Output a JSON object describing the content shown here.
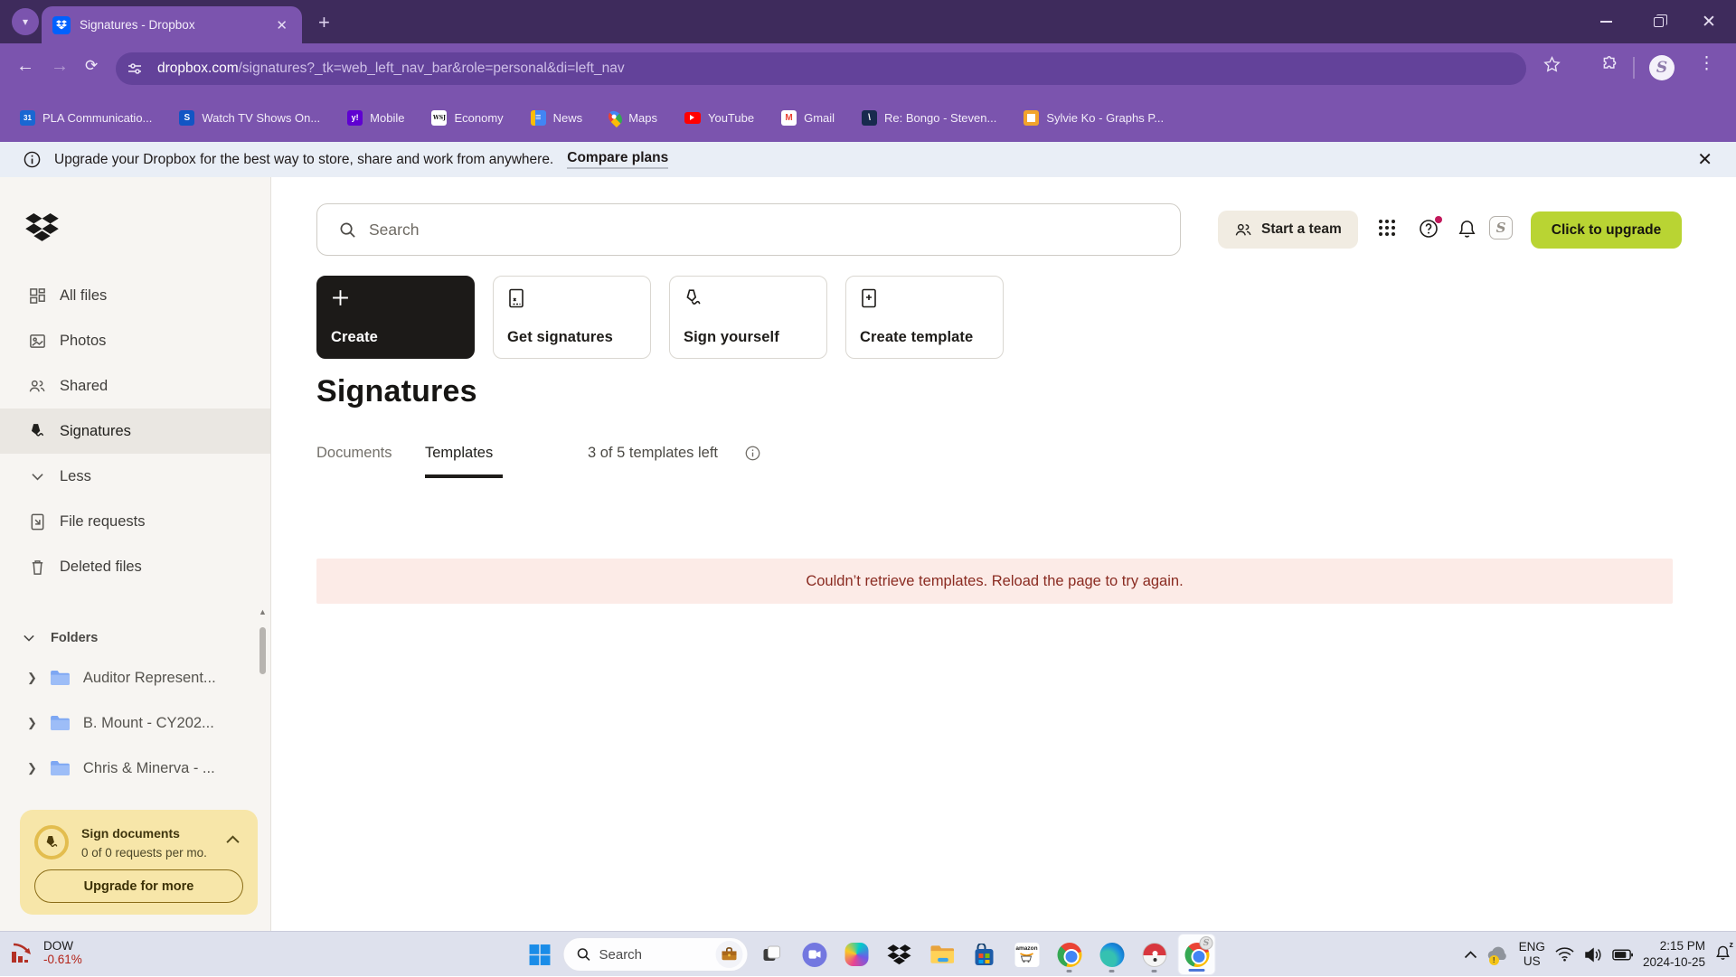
{
  "window": {
    "tab_title": "Signatures - Dropbox"
  },
  "browser": {
    "url_domain": "dropbox.com",
    "url_path": "/signatures?_tk=web_left_nav_bar&role=personal&di=left_nav",
    "bookmarks": [
      {
        "icon": "google-calendar-icon",
        "badge": "31",
        "label": "PLA Communicatio..."
      },
      {
        "icon": "spectrum-icon",
        "badge": "S",
        "label": "Watch TV Shows On..."
      },
      {
        "icon": "yahoo-icon",
        "badge": "y!",
        "label": "Mobile"
      },
      {
        "icon": "wsj-icon",
        "badge": "WSJ",
        "label": "Economy"
      },
      {
        "icon": "google-news-icon",
        "badge": "≡",
        "label": "News"
      },
      {
        "icon": "google-maps-icon",
        "badge": "",
        "label": "Maps"
      },
      {
        "icon": "youtube-icon",
        "badge": "",
        "label": "YouTube"
      },
      {
        "icon": "gmail-icon",
        "badge": "M",
        "label": "Gmail"
      },
      {
        "icon": "mail-thread-icon",
        "badge": "\\",
        "label": "Re: Bongo - Steven..."
      },
      {
        "icon": "doc-yellow-icon",
        "badge": "",
        "label": "Sylvie Ko - Graphs P..."
      }
    ]
  },
  "banner": {
    "message": "Upgrade your Dropbox for the best way to store, share and work from anywhere.",
    "link_label": "Compare plans"
  },
  "sidebar": {
    "items": [
      {
        "icon": "all-files-icon",
        "label": "All files"
      },
      {
        "icon": "photos-icon",
        "label": "Photos"
      },
      {
        "icon": "people-icon",
        "label": "Shared"
      },
      {
        "icon": "pen-icon",
        "label": "Signatures"
      },
      {
        "icon": "chevron-down-icon",
        "label": "Less"
      },
      {
        "icon": "file-request-icon",
        "label": "File requests"
      },
      {
        "icon": "trash-icon",
        "label": "Deleted files"
      }
    ],
    "folders_header": "Folders",
    "folders": [
      {
        "label": "Auditor Represent..."
      },
      {
        "label": "B. Mount - CY202..."
      },
      {
        "label": "Chris & Minerva - ..."
      }
    ],
    "upgrade_card": {
      "title": "Sign documents",
      "subtitle": "0 of 0 requests per mo.",
      "button": "Upgrade for more"
    }
  },
  "topbar": {
    "search_placeholder": "Search",
    "start_team": "Start a team",
    "upgrade_button": "Click to upgrade",
    "avatar_initial": "S"
  },
  "actions": [
    {
      "label": "Create"
    },
    {
      "label": "Get signatures"
    },
    {
      "label": "Sign yourself"
    },
    {
      "label": "Create template"
    }
  ],
  "content": {
    "title": "Signatures",
    "tab_documents": "Documents",
    "tab_templates": "Templates",
    "templates_left": "3 of 5 templates left",
    "error": "Couldn’t retrieve templates. Reload the page to try again."
  },
  "taskbar": {
    "stock_name": "DOW",
    "stock_change": "-0.61%",
    "search_placeholder": "Search",
    "lang_line1": "ENG",
    "lang_line2": "US",
    "time": "2:15 PM",
    "date": "2024-10-25"
  },
  "colors": {
    "theme_purple": "#7b54ae",
    "titlebar_purple": "#3e2b5c",
    "url_pill_purple": "#63429a",
    "dropbox_blue": "#0061fe",
    "accent_lime": "#b9d433",
    "banner_bg": "#e9eef6",
    "error_bg": "#fcebe7",
    "error_text": "#8a2b21",
    "card_yellow": "#f7e6a9",
    "sidebar_bg": "#f7f5f2",
    "taskbar_bg": "#dee1ed"
  }
}
